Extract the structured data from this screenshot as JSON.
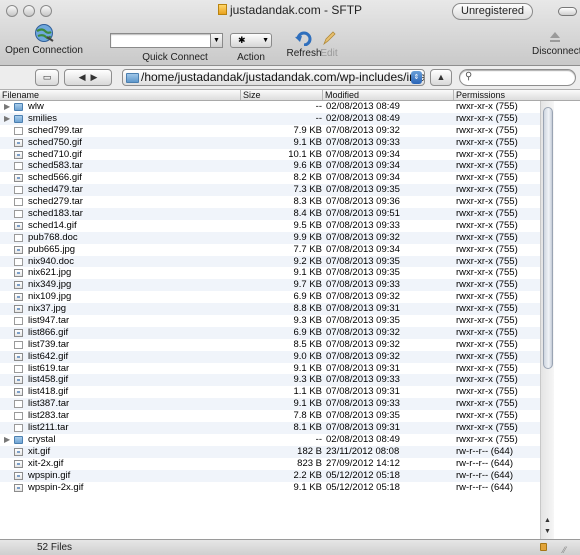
{
  "window": {
    "title": "justadandak.com - SFTP",
    "badge": "Unregistered"
  },
  "toolbar": {
    "open_connection": "Open Connection",
    "quick_connect": "Quick Connect",
    "action": "Action",
    "refresh": "Refresh",
    "edit": "Edit",
    "disconnect": "Disconnect"
  },
  "pathbar": {
    "path": "/home/justadandak/justadandak.com/wp-includes/images",
    "search_placeholder": ""
  },
  "columns": {
    "filename": "Filename",
    "size": "Size",
    "modified": "Modified",
    "permissions": "Permissions"
  },
  "files": [
    {
      "name": "wlw",
      "size": "--",
      "modified": "02/08/2013 08:49",
      "perm": "rwxr-xr-x (755)",
      "kind": "folder"
    },
    {
      "name": "smilies",
      "size": "--",
      "modified": "02/08/2013 08:49",
      "perm": "rwxr-xr-x (755)",
      "kind": "folder"
    },
    {
      "name": "sched799.tar",
      "size": "7.9 KB",
      "modified": "07/08/2013 09:32",
      "perm": "rwxr-xr-x (755)",
      "kind": "file"
    },
    {
      "name": "sched750.gif",
      "size": "9.1 KB",
      "modified": "07/08/2013 09:33",
      "perm": "rwxr-xr-x (755)",
      "kind": "image"
    },
    {
      "name": "sched710.gif",
      "size": "10.1 KB",
      "modified": "07/08/2013 09:34",
      "perm": "rwxr-xr-x (755)",
      "kind": "image"
    },
    {
      "name": "sched583.tar",
      "size": "9.6 KB",
      "modified": "07/08/2013 09:34",
      "perm": "rwxr-xr-x (755)",
      "kind": "file"
    },
    {
      "name": "sched566.gif",
      "size": "8.2 KB",
      "modified": "07/08/2013 09:34",
      "perm": "rwxr-xr-x (755)",
      "kind": "image"
    },
    {
      "name": "sched479.tar",
      "size": "7.3 KB",
      "modified": "07/08/2013 09:35",
      "perm": "rwxr-xr-x (755)",
      "kind": "file"
    },
    {
      "name": "sched279.tar",
      "size": "8.3 KB",
      "modified": "07/08/2013 09:36",
      "perm": "rwxr-xr-x (755)",
      "kind": "file"
    },
    {
      "name": "sched183.tar",
      "size": "8.4 KB",
      "modified": "07/08/2013 09:51",
      "perm": "rwxr-xr-x (755)",
      "kind": "file"
    },
    {
      "name": "sched14.gif",
      "size": "9.5 KB",
      "modified": "07/08/2013 09:33",
      "perm": "rwxr-xr-x (755)",
      "kind": "image"
    },
    {
      "name": "pub768.doc",
      "size": "9.9 KB",
      "modified": "07/08/2013 09:32",
      "perm": "rwxr-xr-x (755)",
      "kind": "file"
    },
    {
      "name": "pub665.jpg",
      "size": "7.7 KB",
      "modified": "07/08/2013 09:34",
      "perm": "rwxr-xr-x (755)",
      "kind": "image"
    },
    {
      "name": "nix940.doc",
      "size": "9.2 KB",
      "modified": "07/08/2013 09:35",
      "perm": "rwxr-xr-x (755)",
      "kind": "file"
    },
    {
      "name": "nix621.jpg",
      "size": "9.1 KB",
      "modified": "07/08/2013 09:35",
      "perm": "rwxr-xr-x (755)",
      "kind": "image"
    },
    {
      "name": "nix349.jpg",
      "size": "9.7 KB",
      "modified": "07/08/2013 09:33",
      "perm": "rwxr-xr-x (755)",
      "kind": "image"
    },
    {
      "name": "nix109.jpg",
      "size": "6.9 KB",
      "modified": "07/08/2013 09:32",
      "perm": "rwxr-xr-x (755)",
      "kind": "image"
    },
    {
      "name": "nix37.jpg",
      "size": "8.8 KB",
      "modified": "07/08/2013 09:31",
      "perm": "rwxr-xr-x (755)",
      "kind": "image"
    },
    {
      "name": "list947.tar",
      "size": "9.3 KB",
      "modified": "07/08/2013 09:35",
      "perm": "rwxr-xr-x (755)",
      "kind": "file"
    },
    {
      "name": "list866.gif",
      "size": "6.9 KB",
      "modified": "07/08/2013 09:32",
      "perm": "rwxr-xr-x (755)",
      "kind": "image"
    },
    {
      "name": "list739.tar",
      "size": "8.5 KB",
      "modified": "07/08/2013 09:32",
      "perm": "rwxr-xr-x (755)",
      "kind": "file"
    },
    {
      "name": "list642.gif",
      "size": "9.0 KB",
      "modified": "07/08/2013 09:32",
      "perm": "rwxr-xr-x (755)",
      "kind": "image"
    },
    {
      "name": "list619.tar",
      "size": "9.1 KB",
      "modified": "07/08/2013 09:31",
      "perm": "rwxr-xr-x (755)",
      "kind": "file"
    },
    {
      "name": "list458.gif",
      "size": "9.3 KB",
      "modified": "07/08/2013 09:33",
      "perm": "rwxr-xr-x (755)",
      "kind": "image"
    },
    {
      "name": "list418.gif",
      "size": "1.1 KB",
      "modified": "07/08/2013 09:31",
      "perm": "rwxr-xr-x (755)",
      "kind": "image"
    },
    {
      "name": "list387.tar",
      "size": "9.1 KB",
      "modified": "07/08/2013 09:33",
      "perm": "rwxr-xr-x (755)",
      "kind": "file"
    },
    {
      "name": "list283.tar",
      "size": "7.8 KB",
      "modified": "07/08/2013 09:35",
      "perm": "rwxr-xr-x (755)",
      "kind": "file"
    },
    {
      "name": "list211.tar",
      "size": "8.1 KB",
      "modified": "07/08/2013 09:31",
      "perm": "rwxr-xr-x (755)",
      "kind": "file"
    },
    {
      "name": "crystal",
      "size": "--",
      "modified": "02/08/2013 08:49",
      "perm": "rwxr-xr-x (755)",
      "kind": "folder"
    },
    {
      "name": "xit.gif",
      "size": "182 B",
      "modified": "23/11/2012 08:08",
      "perm": "rw-r--r-- (644)",
      "kind": "image"
    },
    {
      "name": "xit-2x.gif",
      "size": "823 B",
      "modified": "27/09/2012 14:12",
      "perm": "rw-r--r-- (644)",
      "kind": "image"
    },
    {
      "name": "wpspin.gif",
      "size": "2.2 KB",
      "modified": "05/12/2012 05:18",
      "perm": "rw-r--r-- (644)",
      "kind": "image"
    },
    {
      "name": "wpspin-2x.gif",
      "size": "9.1 KB",
      "modified": "05/12/2012 05:18",
      "perm": "rw-r--r-- (644)",
      "kind": "image"
    }
  ],
  "status": {
    "count": "52 Files"
  },
  "colors": {
    "row_alt": "#f0f4fa",
    "folder": "#6fa3d3",
    "accent": "#2a65b8"
  },
  "icons": {
    "open_connection": "globe-icon",
    "refresh": "refresh-icon",
    "edit": "pencil-icon",
    "disconnect": "eject-icon",
    "action": "gear-icon"
  }
}
